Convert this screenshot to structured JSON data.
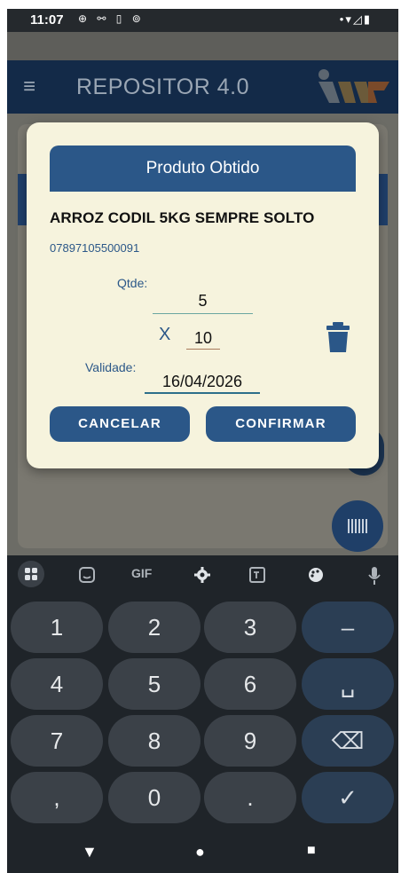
{
  "status_bar": {
    "time": "11:07",
    "left_icons": "⊕ ⚯ ▯ ⊚",
    "right_icons": "•▾◿▮"
  },
  "app": {
    "title": "REPOSITOR 4.0",
    "menu_icon": "≡"
  },
  "dialog": {
    "title": "Produto Obtido",
    "product_name": "ARROZ CODIL 5KG SEMPRE SOLTO",
    "barcode": "07897105500091",
    "qtde_label": "Qtde:",
    "qtde_value": "5",
    "multiplier_symbol": "X",
    "multiplier_value": "10",
    "validade_label": "Validade:",
    "validade_value": "16/04/2026",
    "cancel_label": "CANCELAR",
    "confirm_label": "CONFIRMAR"
  },
  "keyboard": {
    "toolbar_gif": "GIF",
    "rows": [
      [
        "1",
        "2",
        "3",
        "–"
      ],
      [
        "4",
        "5",
        "6",
        "␣"
      ],
      [
        "7",
        "8",
        "9",
        "⌫"
      ],
      [
        ",",
        "0",
        ".",
        "✓"
      ]
    ]
  },
  "navbar": {
    "back": "▼",
    "home": "●",
    "recents": "■"
  },
  "colors": {
    "primary": "#2b5788",
    "dialog_bg": "#f6f3dd",
    "appbar": "#132a48",
    "keyboard_bg": "#1f2429"
  }
}
